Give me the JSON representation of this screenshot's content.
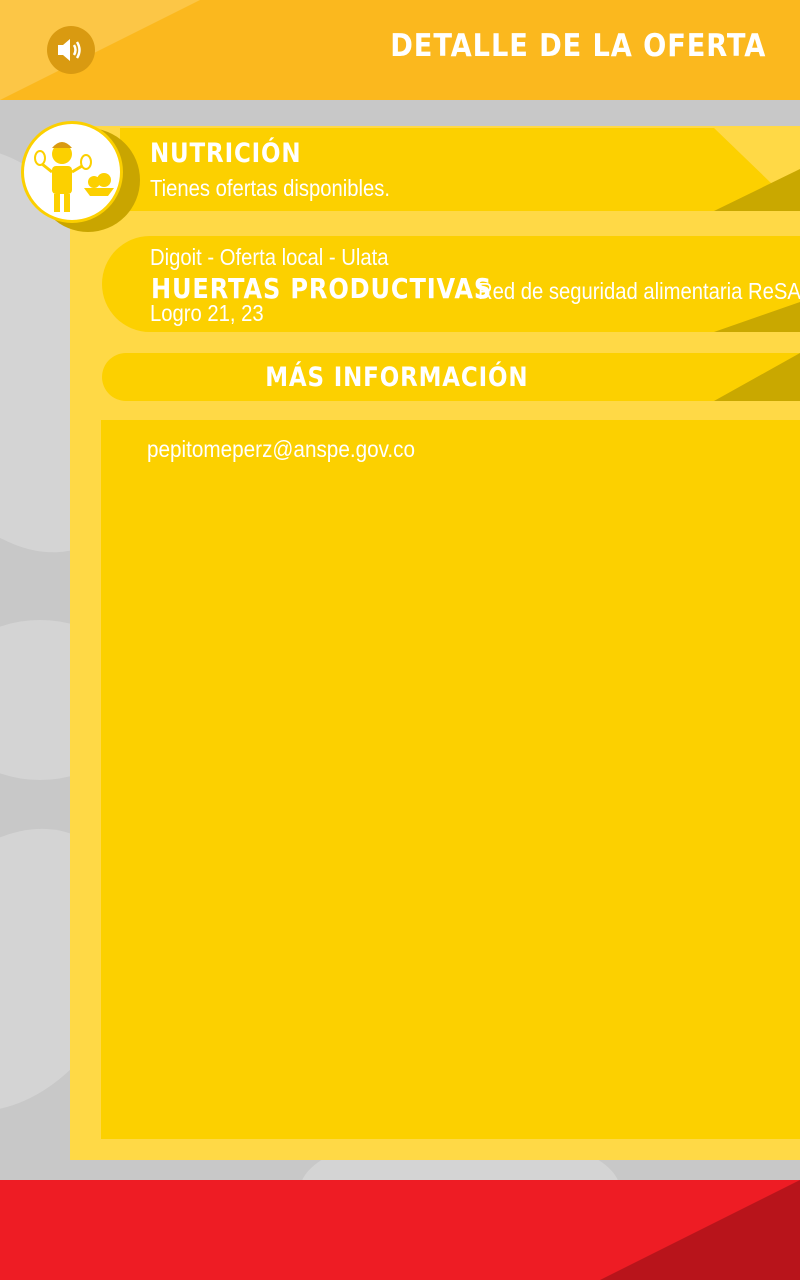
{
  "header": {
    "title": "DETALLE DE LA OFERTA",
    "sound_icon": "speaker-icon"
  },
  "category": {
    "title": "NUTRICIÓN",
    "subtitle": "Tienes  ofertas disponibles.",
    "icon": "nutrition-person-icon"
  },
  "offer": {
    "meta": "Digoit - Oferta local - Ulata",
    "name": "HUERTAS PRODUCTIVAS",
    "program": "Red de seguridad alimentaria ReSA",
    "logro": "Logro 21, 23"
  },
  "more_info": {
    "label": "MÁS INFORMACIÓN"
  },
  "info": {
    "email": "pepitomeperz@anspe.gov.co"
  },
  "colors": {
    "header": "#fbb81e",
    "panel": "#ffd946",
    "card": "#fcd000",
    "footer": "#ee1c24"
  }
}
